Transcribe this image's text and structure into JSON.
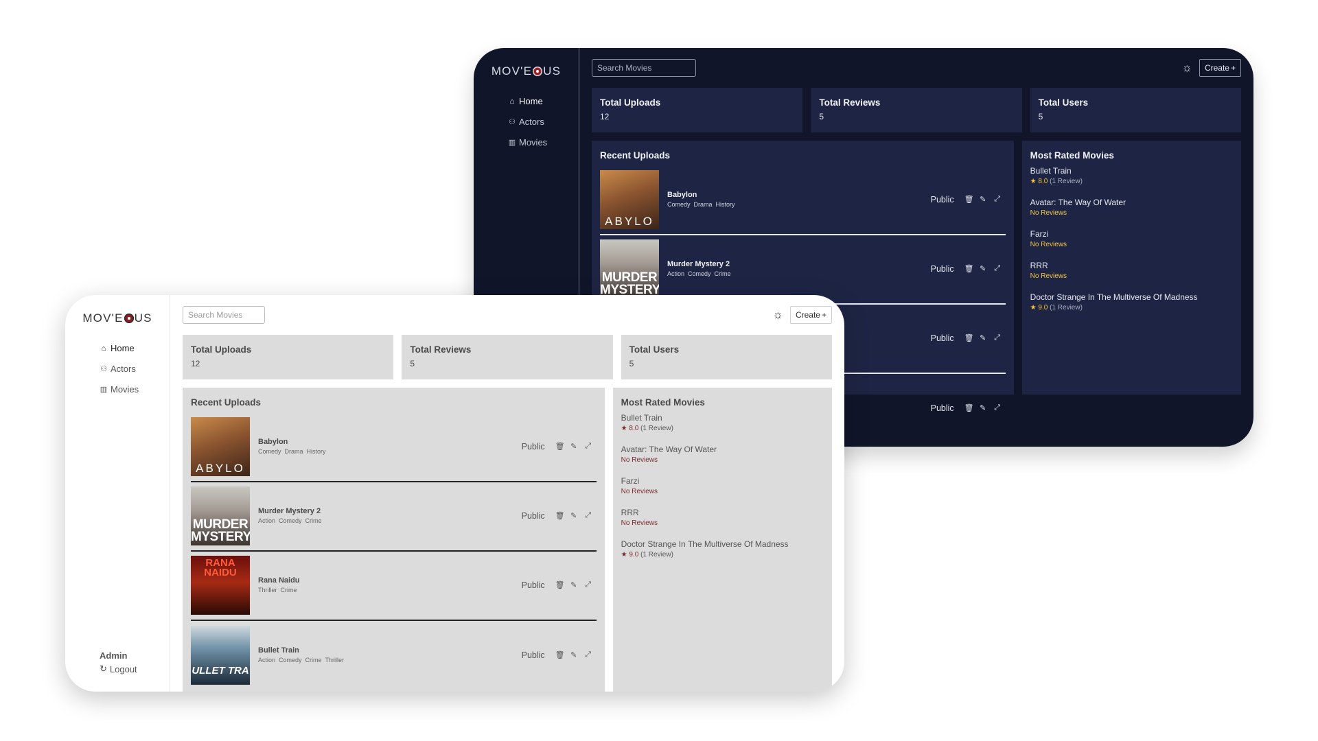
{
  "app": {
    "logo_left": "MOV",
    "logo_mid": "'E",
    "logo_right": "US"
  },
  "colors": {
    "dark_bg": "#10152a",
    "dark_panel": "#1e2544",
    "light_panel": "#dcdcdc",
    "accent_star_dark": "#f5c542",
    "accent_star_light": "#7a2a2e"
  },
  "sidebar": {
    "items": [
      {
        "label": "Home",
        "icon": "home-icon",
        "glyph": "⌂"
      },
      {
        "label": "Actors",
        "icon": "actors-icon",
        "glyph": "⚇"
      },
      {
        "label": "Movies",
        "icon": "film-icon",
        "glyph": "▥"
      }
    ],
    "footer": {
      "user": "Admin",
      "logout": "Logout",
      "logout_glyph": "↻"
    }
  },
  "header": {
    "search_placeholder": "Search Movies",
    "theme_glyph": "☼",
    "create_label": "Create",
    "create_glyph": "+"
  },
  "stats": [
    {
      "label": "Total Uploads",
      "value": "12"
    },
    {
      "label": "Total Reviews",
      "value": "5"
    },
    {
      "label": "Total Users",
      "value": "5"
    }
  ],
  "recent": {
    "title": "Recent Uploads",
    "items": [
      {
        "title": "Babylon",
        "genres": [
          "Comedy",
          "Drama",
          "History"
        ],
        "visibility": "Public",
        "poster_text": "ABYLO"
      },
      {
        "title": "Murder Mystery 2",
        "genres": [
          "Action",
          "Comedy",
          "Crime"
        ],
        "visibility": "Public",
        "poster_text": "MURDER MYSTERY"
      },
      {
        "title": "Rana Naidu",
        "genres": [
          "Thriller",
          "Crime"
        ],
        "visibility": "Public",
        "poster_text": "RANA NAIDU"
      },
      {
        "title": "Bullet Train",
        "genres": [
          "Action",
          "Comedy",
          "Crime",
          "Thriller"
        ],
        "visibility": "Public",
        "poster_text": "ULLET TRA"
      }
    ],
    "action_glyphs": {
      "delete": "🗑",
      "edit": "✎",
      "open": "⤢"
    }
  },
  "rated": {
    "title": "Most Rated Movies",
    "items": [
      {
        "name": "Bullet Train",
        "score": "8.0",
        "count": "(1 Review)",
        "no_reviews": null
      },
      {
        "name": "Avatar: The Way Of Water",
        "score": null,
        "count": null,
        "no_reviews": "No Reviews"
      },
      {
        "name": "Farzi",
        "score": null,
        "count": null,
        "no_reviews": "No Reviews"
      },
      {
        "name": "RRR",
        "score": null,
        "count": null,
        "no_reviews": "No Reviews"
      },
      {
        "name": "Doctor Strange In The Multiverse Of Madness",
        "score": "9.0",
        "count": "(1 Review)",
        "no_reviews": null
      }
    ],
    "star_glyph": "★"
  }
}
